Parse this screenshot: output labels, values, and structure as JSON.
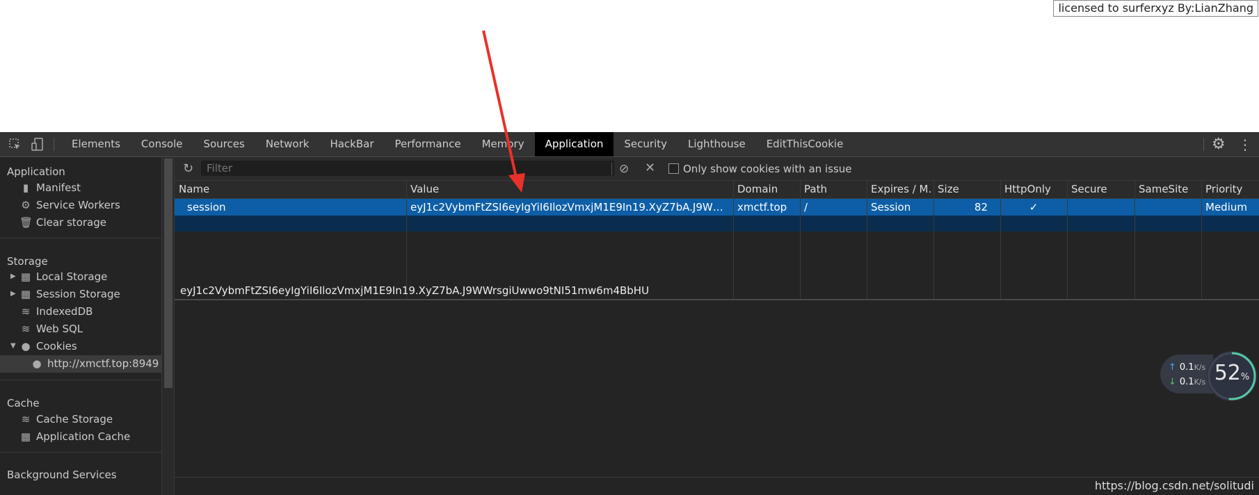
{
  "page": {
    "license_text": "licensed to surferxyz By:LianZhang"
  },
  "toolbar": {
    "tabs": [
      {
        "label": "Elements"
      },
      {
        "label": "Console"
      },
      {
        "label": "Sources"
      },
      {
        "label": "Network"
      },
      {
        "label": "HackBar"
      },
      {
        "label": "Performance"
      },
      {
        "label": "Memory"
      },
      {
        "label": "Application"
      },
      {
        "label": "Security"
      },
      {
        "label": "Lighthouse"
      },
      {
        "label": "EditThisCookie"
      }
    ],
    "active_tab": "Application",
    "icons": [
      "inspect-icon",
      "device-toggle-icon",
      "settings-gear-icon",
      "more-options-icon"
    ]
  },
  "sidebar": {
    "sections": [
      {
        "title": "Application",
        "items": [
          "Manifest",
          "Service Workers",
          "Clear storage"
        ]
      },
      {
        "title": "Storage",
        "items": [
          "Local Storage",
          "Session Storage",
          "IndexedDB",
          "Web SQL",
          "Cookies"
        ]
      },
      {
        "title": "Cache",
        "items": [
          "Cache Storage",
          "Application Cache"
        ]
      },
      {
        "title": "Background Services",
        "items": []
      }
    ],
    "cookie_origin": "http://xmctf.top:8949"
  },
  "filterbar": {
    "placeholder": "Filter",
    "checkbox_label": "Only show cookies with an issue",
    "checkbox_checked": false
  },
  "cookies_table": {
    "columns": [
      "Name",
      "Value",
      "Domain",
      "Path",
      "Expires / M...",
      "Size",
      "HttpOnly",
      "Secure",
      "SameSite",
      "Priority"
    ],
    "rows": [
      {
        "name": "session",
        "value": "eyJ1c2VybmFtZSI6eyIgYiI6IlozVmxjM1E9In19.XyZ7bA.J9WWrsgiUw...",
        "domain": "xmctf.top",
        "path": "/",
        "expires": "Session",
        "size": "82",
        "httponly": "✓",
        "secure": "",
        "samesite": "",
        "priority": "Medium"
      }
    ]
  },
  "value_view": {
    "text": "eyJ1c2VybmFtZSI6eyIgYiI6IlozVmxjM1E9In19.XyZ7bA.J9WWrsgiUwwo9tNI51mw6m4BbHU"
  },
  "net_widget": {
    "upload": "0.1",
    "download": "0.1",
    "unit": "K/s",
    "cpu_percent": "52",
    "percent_sign": "%"
  },
  "watermark": "https://blog.csdn.net/solitudi",
  "colors": {
    "annotation_arrow": "#e8312a",
    "selected_row": "#0d5ea6",
    "panel_bg": "#242424"
  }
}
